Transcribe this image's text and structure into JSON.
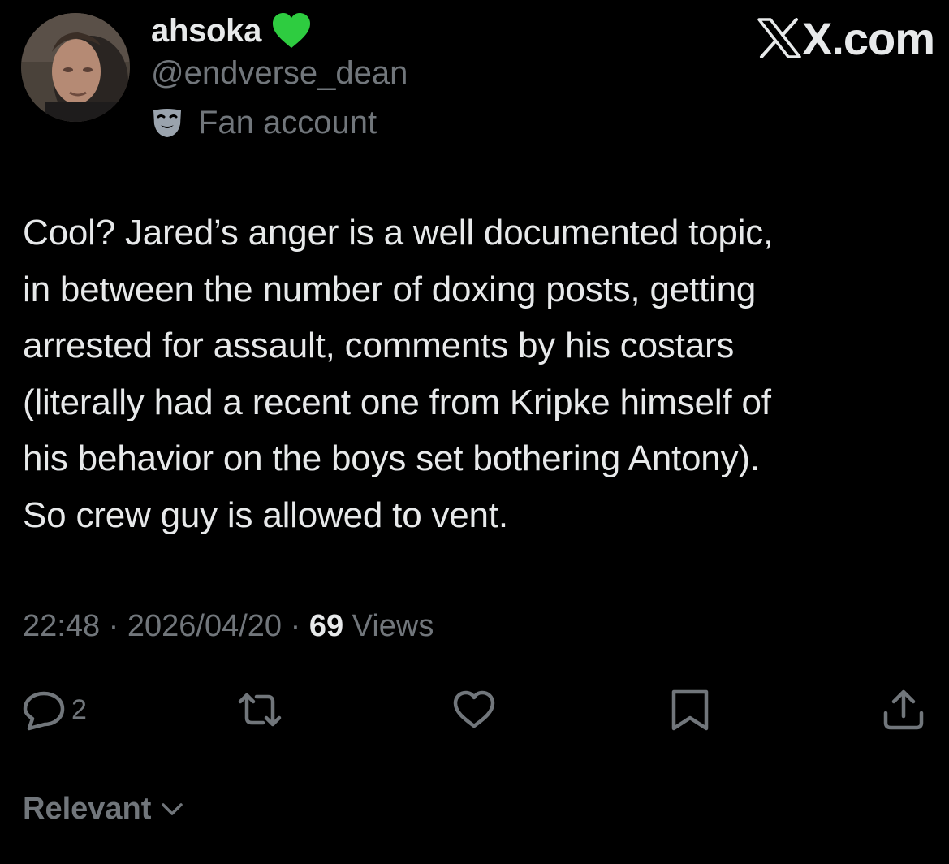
{
  "user": {
    "display_name": "ahsoka",
    "handle": "@endverse_dean",
    "label": "Fan account",
    "name_emoji_icon": "green-heart-icon",
    "label_icon": "theater-mask-icon"
  },
  "brand": {
    "domain": "X.com",
    "logo_icon": "x-logo-icon"
  },
  "tweet": {
    "lines": [
      "Cool? Jared’s anger is a well documented topic,",
      "in between the number of doxing posts, getting",
      "arrested for assault, comments by his costars",
      "(literally had a recent one from Kripke himself of",
      "his behavior on the boys set bothering Antony).",
      "So crew guy is allowed to vent."
    ]
  },
  "meta": {
    "time": "22:48",
    "separator": " · ",
    "date": "2026/04/20",
    "views_count": "69",
    "views_label": " Views"
  },
  "actions": {
    "reply_count": "2",
    "icons": [
      "reply-icon",
      "retweet-icon",
      "like-icon",
      "bookmark-icon",
      "share-icon"
    ]
  },
  "sort": {
    "label": "Relevant",
    "icon": "chevron-down-icon"
  },
  "colors": {
    "background": "#000000",
    "primary_text": "#e7e9ea",
    "secondary_text": "#71767b",
    "heart": "#2ecc40"
  }
}
